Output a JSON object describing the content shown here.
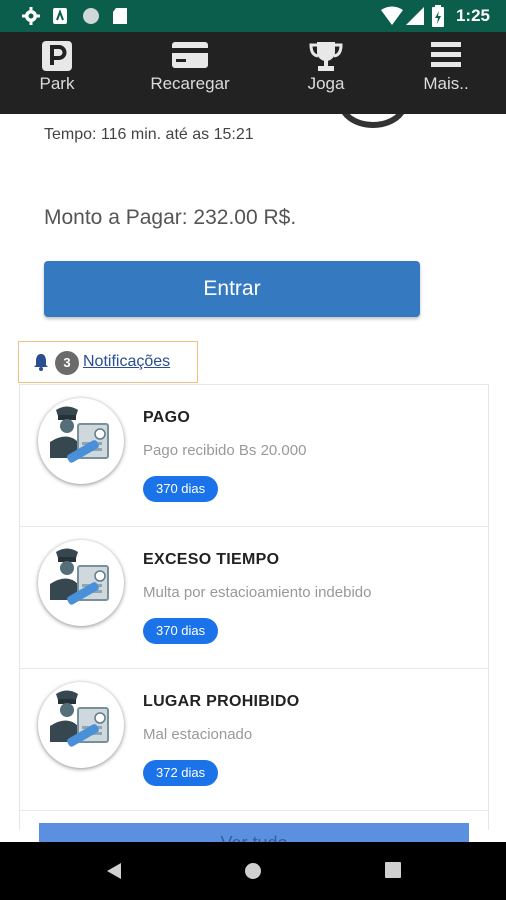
{
  "status_bar": {
    "time": "1:25"
  },
  "nav": {
    "items": [
      {
        "label": "Park",
        "icon": "parking-icon"
      },
      {
        "label": "Recaregar",
        "icon": "credit-card-icon"
      },
      {
        "label": "Joga",
        "icon": "trophy-icon"
      },
      {
        "label": "Mais..",
        "icon": "menu-icon"
      }
    ]
  },
  "session": {
    "tempo": "Tempo: 116 min. até as 15:21",
    "monto": "Monto a Pagar: 232.00 R$.",
    "entrar_label": "Entrar"
  },
  "notifications": {
    "count": "3",
    "link_label": "Notificações",
    "items": [
      {
        "title": "PAGO",
        "description": "Pago recibido Bs 20.000",
        "badge": "370 dias"
      },
      {
        "title": "EXCESO TIEMPO",
        "description": "Multa por estacioamiento indebido",
        "badge": "370 dias"
      },
      {
        "title": "LUGAR PROHIBIDO",
        "description": "Mal estacionado",
        "badge": "372 dias"
      }
    ],
    "ver_todo_label": "Ver tudo"
  },
  "colors": {
    "status_bar": "#0b5d4c",
    "nav_bar": "#222222",
    "primary_button": "#3579c0",
    "badge": "#1a73e8",
    "notif_border": "#f0c080"
  }
}
